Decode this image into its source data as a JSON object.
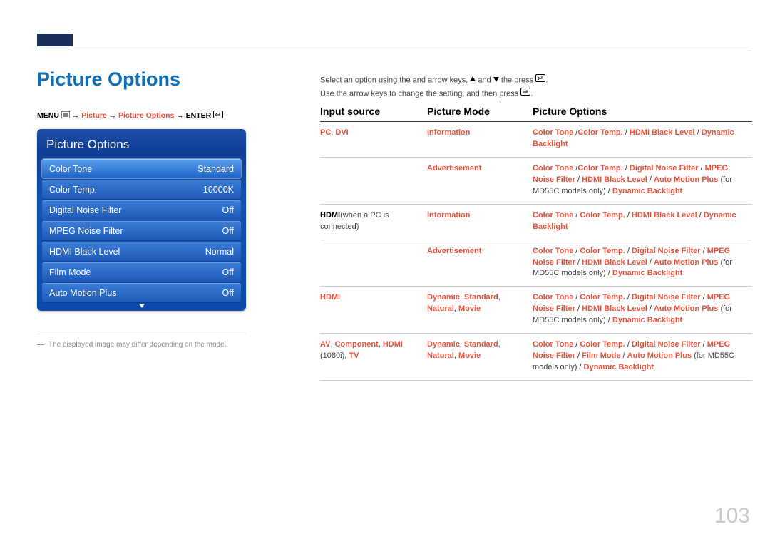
{
  "title": "Picture Options",
  "breadcrumb": {
    "menu": "MENU",
    "arrow": " → ",
    "picture": "Picture",
    "picture_options": "Picture Options",
    "enter": "ENTER"
  },
  "panel": {
    "title": "Picture Options",
    "rows": [
      {
        "label": "Color Tone",
        "value": "Standard"
      },
      {
        "label": "Color Temp.",
        "value": "10000K"
      },
      {
        "label": "Digital Noise Filter",
        "value": "Off"
      },
      {
        "label": "MPEG Noise Filter",
        "value": "Off"
      },
      {
        "label": "HDMI Black Level",
        "value": "Normal"
      },
      {
        "label": "Film Mode",
        "value": "Off"
      },
      {
        "label": "Auto Motion Plus",
        "value": "Off"
      }
    ]
  },
  "note": "The displayed image may differ depending on the model.",
  "instructions": {
    "line1a": "Select an option using the and arrow keys, ",
    "line1b": " and ",
    "line1c": " the press ",
    "line1d": ".",
    "line2a": "Use the arrow keys to change the setting, and then press ",
    "line2b": "."
  },
  "table": {
    "headers": {
      "src": "Input source",
      "mode": "Picture Mode",
      "opts": "Picture Options"
    },
    "rows": [
      {
        "src_html": "<span class='hl'>PC</span><span class='nm'>, </span><span class='hl'>DVI</span>",
        "mode_html": "<span class='hl'>Information</span>",
        "opts_html": "<span class='hl'>Color Tone</span> /<span class='hl'>Color Temp.</span> / <span class='hl'>HDMI Black Level</span> / <span class='hl'>Dynamic Backlight</span>"
      },
      {
        "src_html": "",
        "mode_html": "<span class='hl'>Advertisement</span>",
        "opts_html": "<span class='hl'>Color Tone</span>  /<span class='hl'>Color Temp.</span> / <span class='hl'>Digital Noise Filter</span> / <span class='hl'>MPEG Noise Filter</span>  / <span class='hl'>HDMI Black Level</span> / <span class='hl'>Auto Motion Plus</span> <span class='nm'>(for MD55C models only)</span> / <span class='hl'>Dynamic Backlight</span>"
      },
      {
        "src_html": "<span class='b'>HDMI</span><span class='nm'>(when a PC is connected)</span>",
        "mode_html": "<span class='hl'>Information</span>",
        "opts_html": "<span class='hl'>Color Tone</span> / <span class='hl'>Color Temp.</span> / <span class='hl'>HDMI Black Level</span> / <span class='hl'>Dynamic Backlight</span>"
      },
      {
        "src_html": "",
        "mode_html": "<span class='hl'>Advertisement</span>",
        "opts_html": "<span class='hl'>Color Tone</span> / <span class='hl'>Color Temp.</span> / <span class='hl'>Digital Noise Filter</span> / <span class='hl'>MPEG Noise Filter</span> / <span class='hl'>HDMI Black Level</span> / <span class='hl'>Auto Motion Plus</span> <span class='nm'>(for MD55C models only)</span> / <span class='hl'>Dynamic Backlight</span>"
      },
      {
        "src_html": "<span class='hl'>HDMI</span>",
        "mode_html": "<span class='hl'>Dynamic</span><span class='nm'>, </span><span class='hl'>Standard</span><span class='nm'>, </span><span class='hl'>Natural</span><span class='nm'>, </span><span class='hl'>Movie</span>",
        "opts_html": "<span class='hl'>Color Tone</span> / <span class='hl'>Color Temp.</span> / <span class='hl'>Digital Noise Filter</span> / <span class='hl'>MPEG Noise Filter</span> / <span class='hl'>HDMI Black Level</span> / <span class='hl'>Auto Motion Plus</span> <span class='nm'>(for MD55C models only)</span> / <span class='hl'>Dynamic Backlight</span>"
      },
      {
        "src_html": "<span class='hl'>AV</span><span class='nm'>, </span><span class='hl'>Component</span><span class='nm'>, </span><span class='hl'>HDMI</span> <span class='nm'>(1080i), </span><span class='hl'>TV</span>",
        "mode_html": "<span class='hl'>Dynamic</span><span class='nm'>, </span><span class='hl'>Standard</span><span class='nm'>, </span><span class='hl'>Natural</span><span class='nm'>, </span><span class='hl'>Movie</span>",
        "opts_html": "<span class='hl'>Color Tone</span> / <span class='hl'>Color Temp.</span> / <span class='hl'>Digital Noise Filter</span> / <span class='hl'>MPEG Noise Filter</span> / <span class='hl'>Film Mode</span> / <span class='hl'>Auto Motion Plus</span> <span class='nm'>(for MD55C models only)</span> / <span class='hl'>Dynamic Backlight</span>"
      }
    ]
  },
  "page_number": "103"
}
